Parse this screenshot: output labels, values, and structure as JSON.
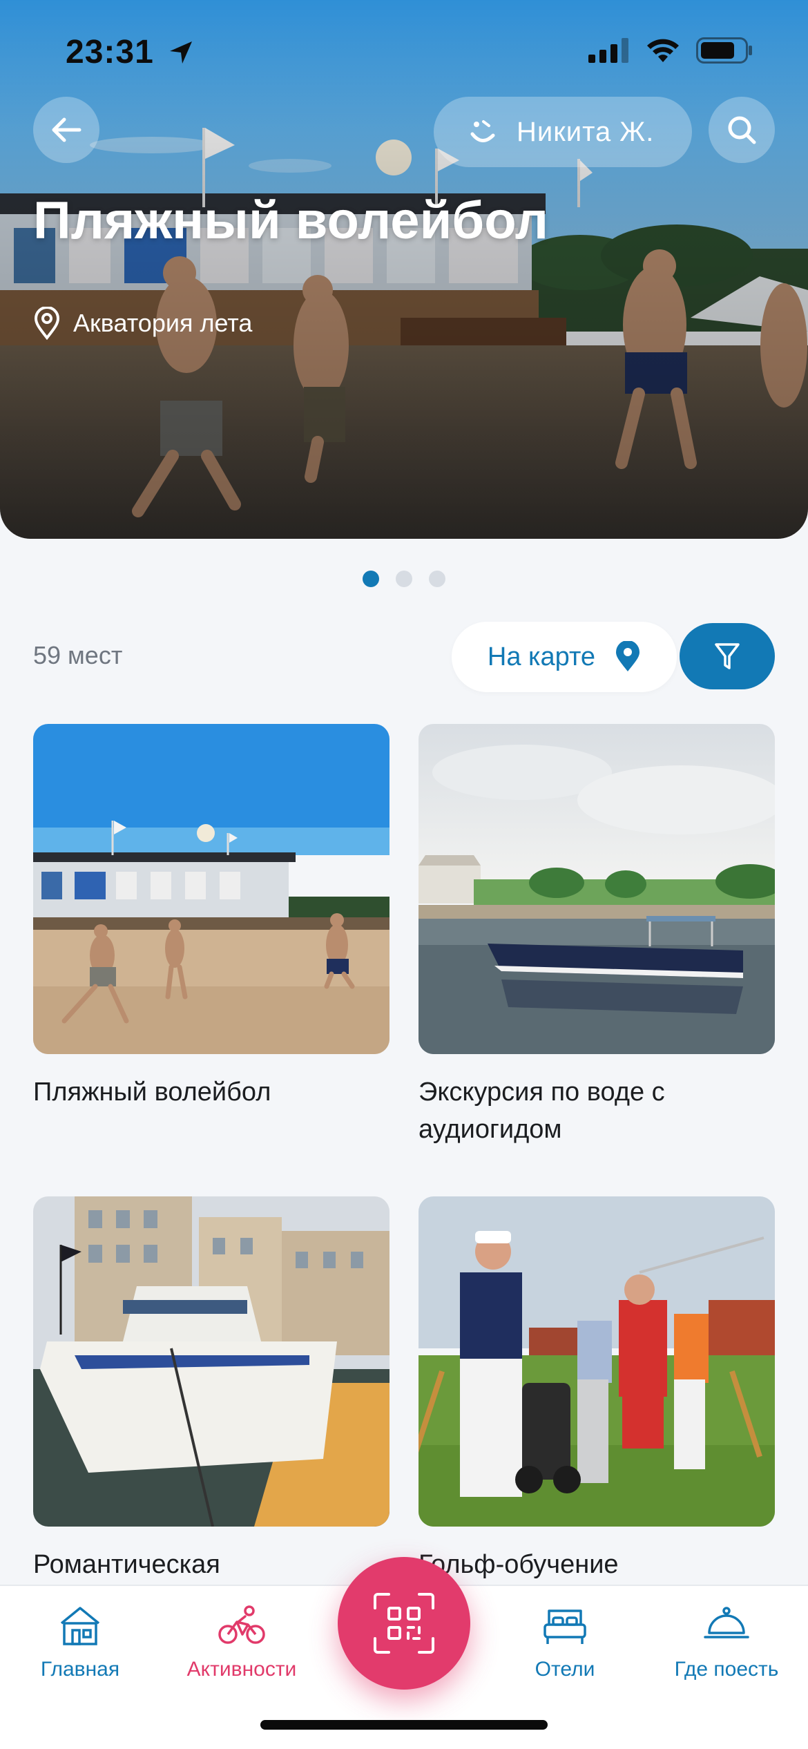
{
  "status_bar": {
    "time": "23:31"
  },
  "header": {
    "title": "Пляжный волейбол",
    "location": "Акватория лета",
    "user": "Никита Ж."
  },
  "carousel": {
    "count": 3,
    "active": 0
  },
  "results": {
    "count_label": "59 мест",
    "map_button": "На карте"
  },
  "cards": [
    {
      "title": "Пляжный волейбол",
      "image": "beach-volleyball-photo"
    },
    {
      "title": "Экскурсия по воде с аудиогидом",
      "image": "boat-on-lake-photo"
    },
    {
      "title": "Романтическая",
      "image": "yacht-at-pier-photo"
    },
    {
      "title": "Гольф-обучение",
      "image": "golf-lesson-photo"
    }
  ],
  "tabbar": {
    "items": [
      {
        "label": "Главная",
        "icon": "house-icon"
      },
      {
        "label": "Активности",
        "icon": "bicycle-icon",
        "active": true
      },
      {
        "label": "Отели",
        "icon": "bed-icon"
      },
      {
        "label": "Где поесть",
        "icon": "cloche-icon"
      }
    ],
    "center_icon": "qr-scan-icon"
  },
  "colors": {
    "accent": "#1279b5",
    "active_tab": "#e13a6a",
    "qr_button": "#e23b6c",
    "background": "#f4f6f9"
  }
}
